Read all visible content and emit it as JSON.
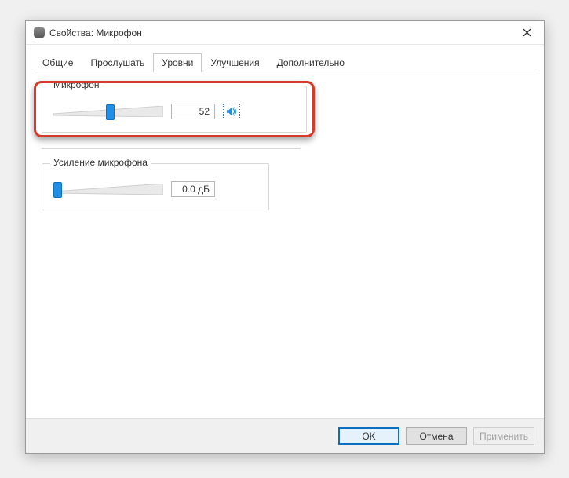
{
  "window": {
    "title": "Свойства: Микрофон"
  },
  "tabs": [
    {
      "label": "Общие"
    },
    {
      "label": "Прослушать"
    },
    {
      "label": "Уровни",
      "active": true
    },
    {
      "label": "Улучшения"
    },
    {
      "label": "Дополнительно"
    }
  ],
  "levels": {
    "microphone": {
      "label": "Микрофон",
      "value": "52",
      "percent": 52
    },
    "boost": {
      "label": "Усиление микрофона",
      "value": "0.0 дБ",
      "percent": 0
    }
  },
  "footer": {
    "ok": "OK",
    "cancel": "Отмена",
    "apply": "Применить"
  }
}
